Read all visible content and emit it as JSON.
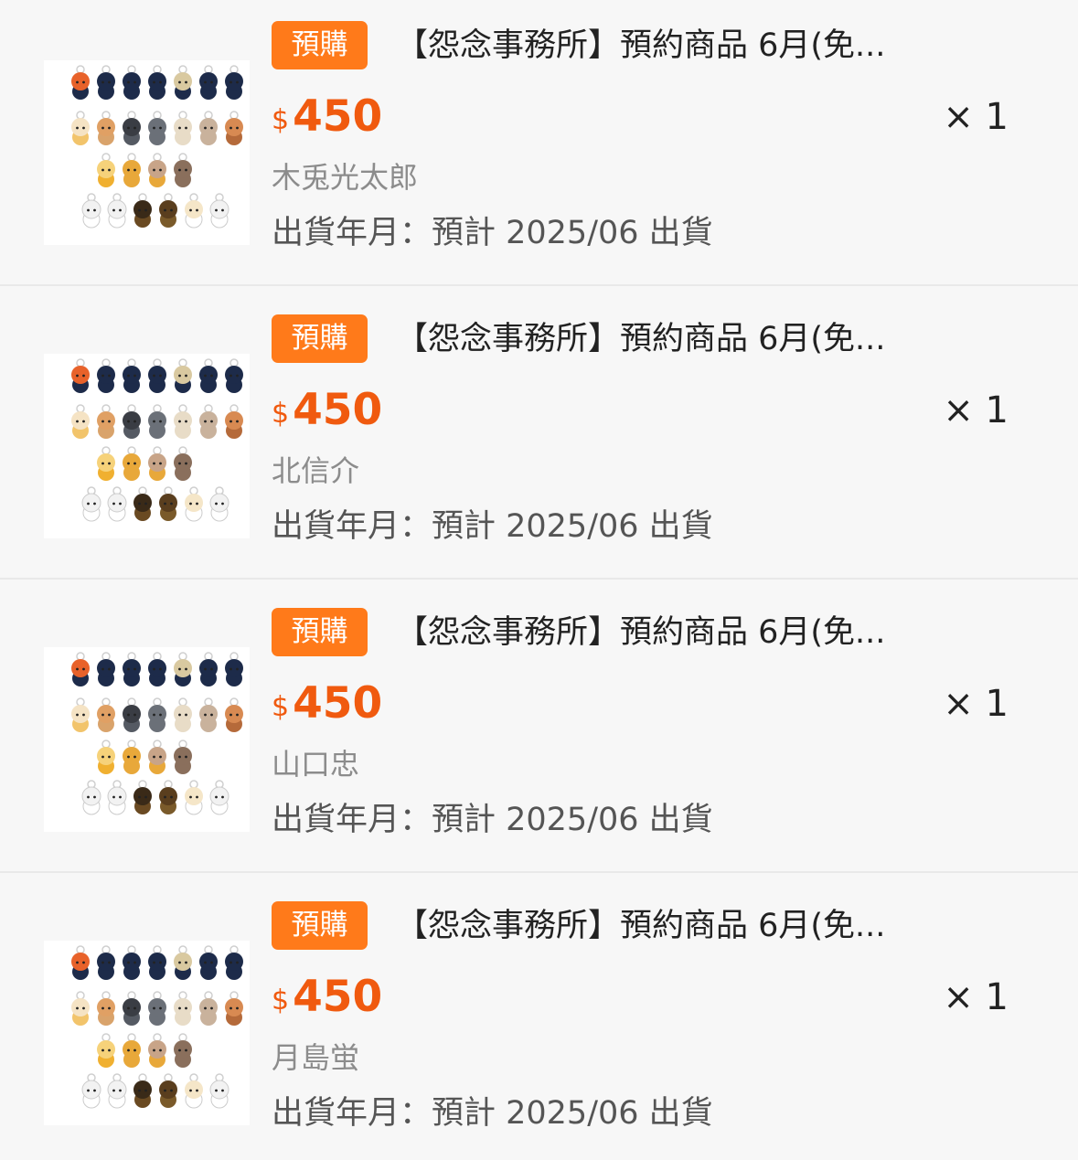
{
  "colors": {
    "background": "#f7f7f7",
    "badge": "#ff7a1a",
    "price": "#f05a0f",
    "muted_text": "#8c8c8c"
  },
  "items": [
    {
      "badge": "預購",
      "title": "【怨念事務所】預約商品 6月(免...",
      "currency": "$",
      "price": "450",
      "quantity": "× 1",
      "variant": "木兎光太郎",
      "shipping": "出貨年月：預計 2025/06 出貨",
      "thumbnail_icon": "character-plush-grid-image"
    },
    {
      "badge": "預購",
      "title": "【怨念事務所】預約商品 6月(免...",
      "currency": "$",
      "price": "450",
      "quantity": "× 1",
      "variant": "北信介",
      "shipping": "出貨年月：預計 2025/06 出貨",
      "thumbnail_icon": "character-plush-grid-image"
    },
    {
      "badge": "預購",
      "title": "【怨念事務所】預約商品 6月(免...",
      "currency": "$",
      "price": "450",
      "quantity": "× 1",
      "variant": "山口忠",
      "shipping": "出貨年月：預計 2025/06 出貨",
      "thumbnail_icon": "character-plush-grid-image"
    },
    {
      "badge": "預購",
      "title": "【怨念事務所】預約商品 6月(免...",
      "currency": "$",
      "price": "450",
      "quantity": "× 1",
      "variant": "月島蛍",
      "shipping": "出貨年月：預計 2025/06 出貨",
      "thumbnail_icon": "character-plush-grid-image"
    }
  ]
}
